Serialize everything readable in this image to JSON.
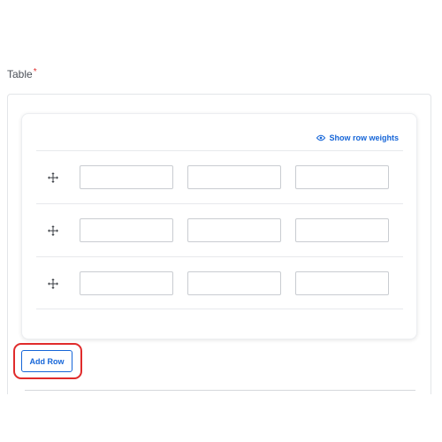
{
  "field": {
    "label": "Table",
    "required_marker": "*"
  },
  "table": {
    "show_weights_label": "Show row weights",
    "rows": [
      {
        "cells": [
          "",
          "",
          ""
        ]
      },
      {
        "cells": [
          "",
          "",
          ""
        ]
      },
      {
        "cells": [
          "",
          "",
          ""
        ]
      }
    ],
    "add_row_label": "Add Row"
  },
  "colors": {
    "accent": "#1565d8",
    "required": "#e03131",
    "highlight": "#e02b2b"
  },
  "icons": {
    "weights": "eye-icon",
    "row_handle": "drag-move-icon"
  }
}
